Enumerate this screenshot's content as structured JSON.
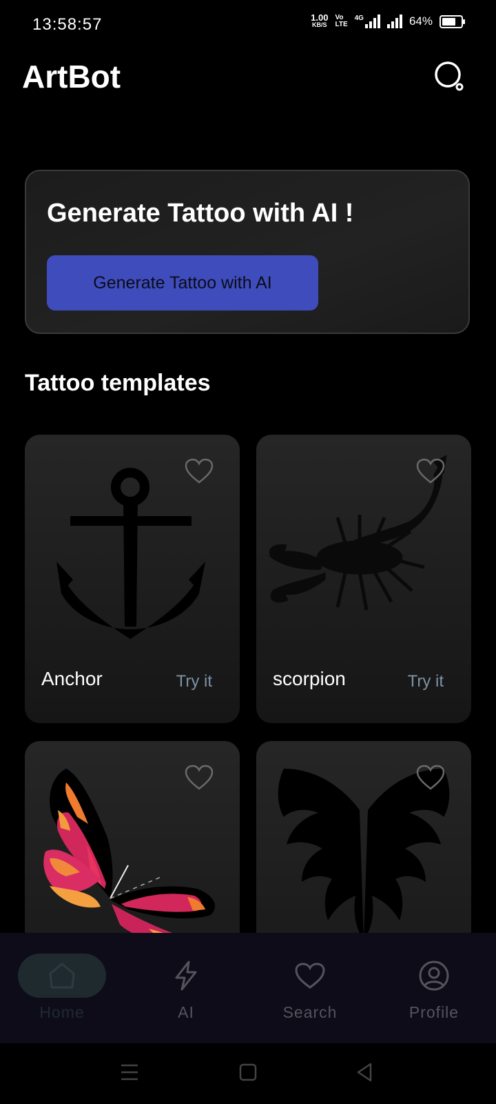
{
  "status_bar": {
    "time": "13:58:57",
    "speed_value": "1.00",
    "speed_unit": "KB/S",
    "volte_top": "Vo",
    "volte_bottom": "LTE",
    "network": "4G",
    "battery": "64%"
  },
  "header": {
    "title": "ArtBot",
    "search_icon": "search-icon"
  },
  "hero": {
    "title": "Generate Tattoo with AI !",
    "button_label": "Generate Tattoo with AI",
    "button_color": "#3f4dbc"
  },
  "templates": {
    "section_title": "Tattoo templates",
    "cards": [
      {
        "name": "Anchor",
        "action": "Try it"
      },
      {
        "name": "scorpion",
        "action": "Try it"
      },
      {
        "name": "",
        "action": ""
      },
      {
        "name": "",
        "action": ""
      }
    ]
  },
  "bottom_nav": {
    "items": [
      {
        "label": "Home",
        "icon": "home-icon",
        "active": true
      },
      {
        "label": "AI",
        "icon": "lightning-icon",
        "active": false
      },
      {
        "label": "Search",
        "icon": "heart-icon",
        "active": false
      },
      {
        "label": "Profile",
        "icon": "profile-icon",
        "active": false
      }
    ]
  },
  "colors": {
    "background": "#000000",
    "accent": "#3f4dbc",
    "try_it": "#7c93a8",
    "nav_background": "#0e0c18"
  }
}
